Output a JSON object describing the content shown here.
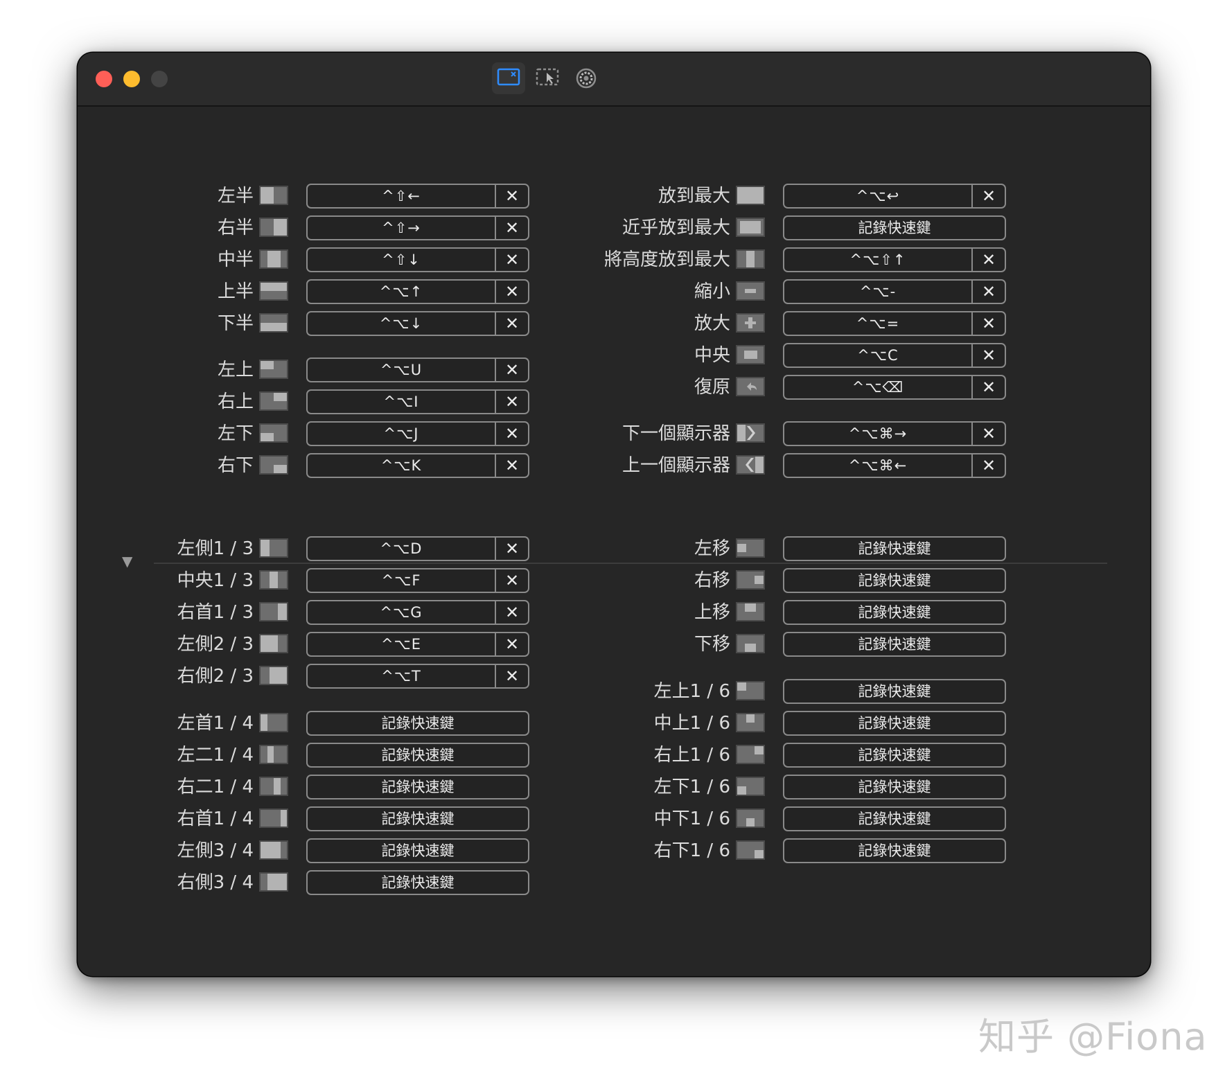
{
  "window": {
    "traffic_lights": {
      "close": "#fe5f57",
      "minimize": "#febc2e",
      "zoom": "#444444"
    },
    "toolbar": [
      "shortcuts-tab-icon",
      "snap-areas-tab-icon",
      "settings-tab-icon"
    ]
  },
  "groups": {
    "top_left": [
      {
        "label": "左半",
        "keys": "^⇧←",
        "thumb": "left-half"
      },
      {
        "label": "右半",
        "keys": "^⇧→",
        "thumb": "right-half"
      },
      {
        "label": "中半",
        "keys": "^⇧↓",
        "thumb": "center-half"
      },
      {
        "label": "上半",
        "keys": "^⌥↑",
        "thumb": "top-half"
      },
      {
        "label": "下半",
        "keys": "^⌥↓",
        "thumb": "bottom-half"
      },
      {
        "label": "左上",
        "keys": "^⌥U",
        "thumb": "top-left"
      },
      {
        "label": "右上",
        "keys": "^⌥I",
        "thumb": "top-right"
      },
      {
        "label": "左下",
        "keys": "^⌥J",
        "thumb": "bottom-left"
      },
      {
        "label": "右下",
        "keys": "^⌥K",
        "thumb": "bottom-right"
      }
    ],
    "top_right": [
      {
        "label": "放到最大",
        "keys": "^⌥↩",
        "thumb": "maximize"
      },
      {
        "label": "近乎放到最大",
        "keys": "記錄快速鍵",
        "thumb": "almost-maximize"
      },
      {
        "label": "將高度放到最大",
        "keys": "^⌥⇧↑",
        "thumb": "maximize-height"
      },
      {
        "label": "縮小",
        "keys": "^⌥-",
        "thumb": "smaller"
      },
      {
        "label": "放大",
        "keys": "^⌥=",
        "thumb": "larger"
      },
      {
        "label": "中央",
        "keys": "^⌥C",
        "thumb": "center"
      },
      {
        "label": "復原",
        "keys": "^⌥⌫",
        "thumb": "restore"
      },
      {
        "label": "下一個顯示器",
        "keys": "^⌥⌘→",
        "thumb": "next-display"
      },
      {
        "label": "上一個顯示器",
        "keys": "^⌥⌘←",
        "thumb": "previous-display"
      }
    ],
    "bottom_left": [
      {
        "label": "左側1 / 3",
        "keys": "^⌥D",
        "thumb": "first-third"
      },
      {
        "label": "中央1 / 3",
        "keys": "^⌥F",
        "thumb": "center-third"
      },
      {
        "label": "右首1 / 3",
        "keys": "^⌥G",
        "thumb": "last-third"
      },
      {
        "label": "左側2 / 3",
        "keys": "^⌥E",
        "thumb": "first-two-thirds"
      },
      {
        "label": "右側2 / 3",
        "keys": "^⌥T",
        "thumb": "last-two-thirds"
      },
      {
        "label": "左首1 / 4",
        "keys": "記錄快速鍵",
        "thumb": "first-fourth"
      },
      {
        "label": "左二1 / 4",
        "keys": "記錄快速鍵",
        "thumb": "second-fourth"
      },
      {
        "label": "右二1 / 4",
        "keys": "記錄快速鍵",
        "thumb": "third-fourth"
      },
      {
        "label": "右首1 / 4",
        "keys": "記錄快速鍵",
        "thumb": "last-fourth"
      },
      {
        "label": "左側3 / 4",
        "keys": "記錄快速鍵",
        "thumb": "first-three-fourths"
      },
      {
        "label": "右側3 / 4",
        "keys": "記錄快速鍵",
        "thumb": "last-three-fourths"
      }
    ],
    "bottom_right": [
      {
        "label": "左移",
        "keys": "記錄快速鍵",
        "thumb": "move-left"
      },
      {
        "label": "右移",
        "keys": "記錄快速鍵",
        "thumb": "move-right"
      },
      {
        "label": "上移",
        "keys": "記錄快速鍵",
        "thumb": "move-up"
      },
      {
        "label": "下移",
        "keys": "記錄快速鍵",
        "thumb": "move-down"
      },
      {
        "label": "左上1 / 6",
        "keys": "記錄快速鍵",
        "thumb": "top-left-sixth"
      },
      {
        "label": "中上1 / 6",
        "keys": "記錄快速鍵",
        "thumb": "top-center-sixth"
      },
      {
        "label": "右上1 / 6",
        "keys": "記錄快速鍵",
        "thumb": "top-right-sixth"
      },
      {
        "label": "左下1 / 6",
        "keys": "記錄快速鍵",
        "thumb": "bottom-left-sixth"
      },
      {
        "label": "中下1 / 6",
        "keys": "記錄快速鍵",
        "thumb": "bottom-center-sixth"
      },
      {
        "label": "右下1 / 6",
        "keys": "記錄快速鍵",
        "thumb": "bottom-right-sixth"
      }
    ]
  },
  "clear_glyph": "✕",
  "disclosure_glyph": "▼",
  "watermark": "知乎 @Fiona"
}
